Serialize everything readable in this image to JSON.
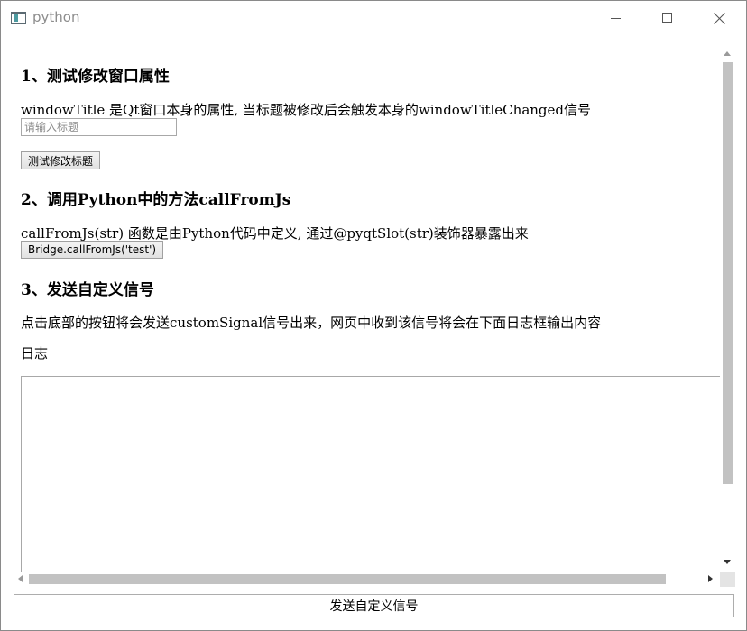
{
  "window": {
    "title": "python"
  },
  "page": {
    "section1": {
      "heading": "1、测试修改窗口属性",
      "description": "windowTitle 是Qt窗口本身的属性, 当标题被修改后会触发本身的windowTitleChanged信号",
      "input_placeholder": "请输入标题",
      "input_value": "",
      "button_label": "测试修改标题"
    },
    "section2": {
      "heading": "2、调用Python中的方法callFromJs",
      "description": "callFromJs(str) 函数是由Python代码中定义, 通过@pyqtSlot(str)装饰器暴露出来",
      "button_label": "Bridge.callFromJs('test')"
    },
    "section3": {
      "heading": "3、发送自定义信号",
      "description": "点击底部的按钮将会发送customSignal信号出来，网页中收到该信号将会在下面日志框输出内容",
      "log_label": "日志",
      "log_value": ""
    }
  },
  "bottom_button": {
    "label": "发送自定义信号"
  },
  "icons": {
    "app": "python-window-icon",
    "minimize": "minimize-icon",
    "maximize": "maximize-icon",
    "close": "close-icon"
  }
}
